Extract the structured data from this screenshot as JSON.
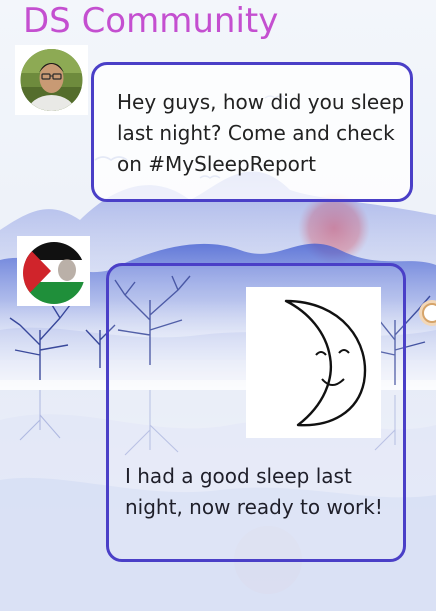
{
  "app": {
    "title": "DS Community"
  },
  "feed": [
    {
      "avatar_icon": "user-photo-avatar",
      "message": "Hey guys, how did you sleep last night? Come and check on #MySleepReport"
    },
    {
      "avatar_icon": "flag-avatar",
      "image_icon": "smiling-crescent-moon-icon",
      "message": "I had a good sleep last night, now ready to work!"
    }
  ],
  "colors": {
    "title": "#c44fd0",
    "bubble_border": "#4a3fc7",
    "background": "#f6f8fc"
  }
}
